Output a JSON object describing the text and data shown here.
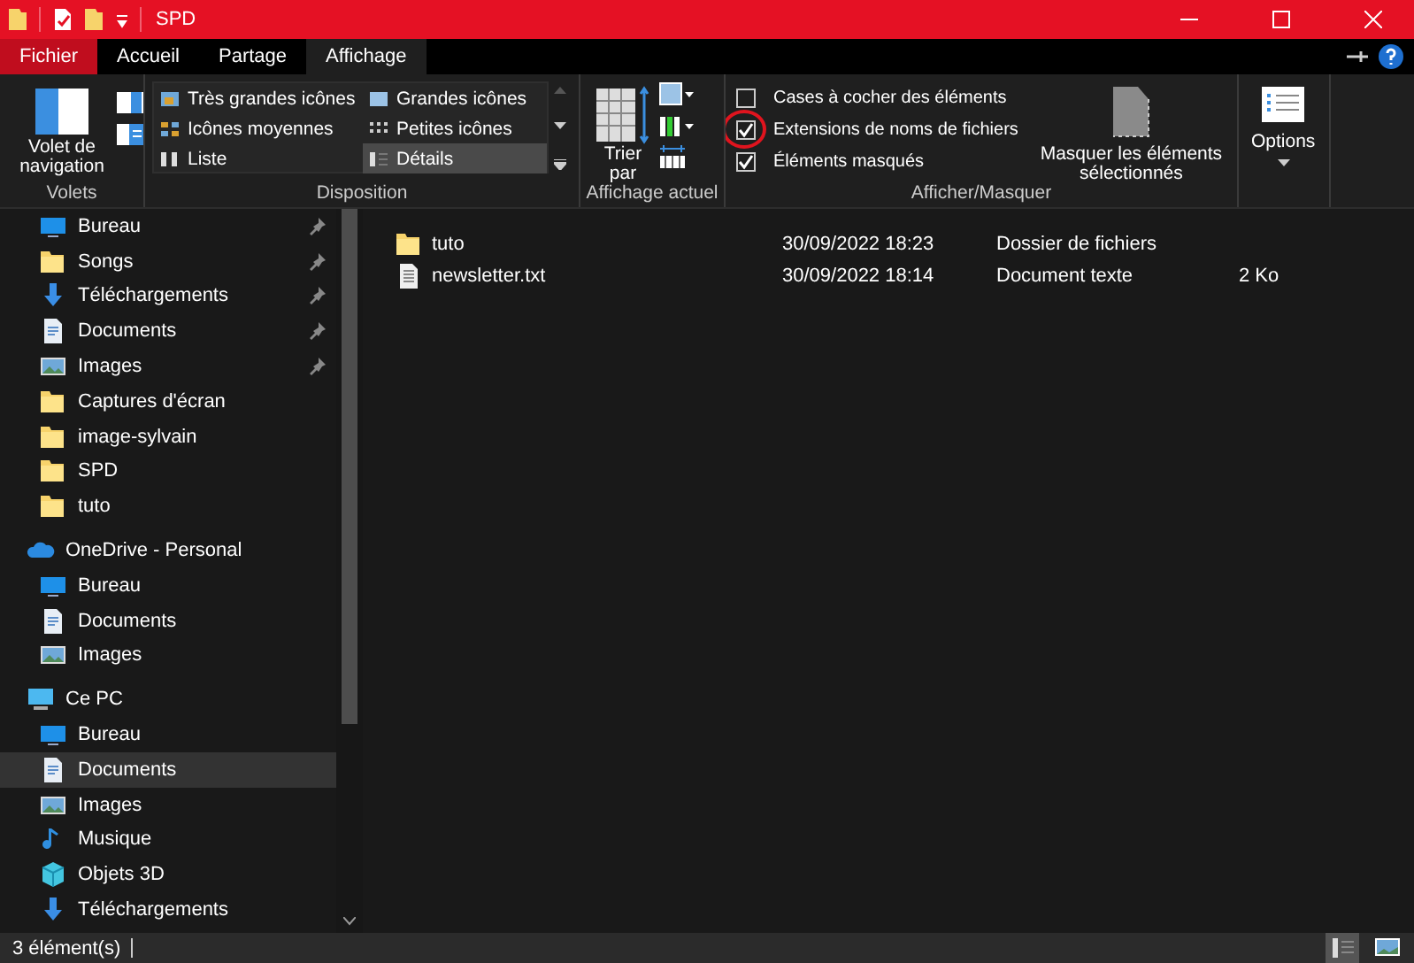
{
  "window": {
    "title": "SPD"
  },
  "tabs": [
    {
      "label": "Fichier",
      "kind": "file",
      "selected": false
    },
    {
      "label": "Accueil",
      "kind": "tab",
      "selected": false
    },
    {
      "label": "Partage",
      "kind": "tab",
      "selected": false
    },
    {
      "label": "Affichage",
      "kind": "tab",
      "selected": true
    }
  ],
  "ribbon": {
    "panes": {
      "nav_label": "Volet de navigation",
      "group": "Volets"
    },
    "layout": {
      "items": [
        {
          "label": "Très grandes icônes",
          "selected": false
        },
        {
          "label": "Grandes icônes",
          "selected": false
        },
        {
          "label": "Icônes moyennes",
          "selected": false
        },
        {
          "label": "Petites icônes",
          "selected": false
        },
        {
          "label": "Liste",
          "selected": false
        },
        {
          "label": "Détails",
          "selected": true
        }
      ],
      "group": "Disposition"
    },
    "current_view": {
      "sort_label": "Trier par",
      "group": "Affichage actuel"
    },
    "show_hide": {
      "checkboxes": [
        {
          "label": "Cases à cocher des éléments",
          "checked": false
        },
        {
          "label": "Extensions de noms de fichiers",
          "checked": true,
          "circled": true
        },
        {
          "label": "Éléments masqués",
          "checked": true,
          "circled": false
        }
      ],
      "hide_selected": "Masquer les éléments sélectionnés",
      "group": "Afficher/Masquer"
    },
    "options": {
      "label": "Options"
    }
  },
  "sidebar": {
    "quick_access": [
      {
        "label": "Bureau",
        "kind": "desktop",
        "pinned": true,
        "selected": false
      },
      {
        "label": "Songs",
        "kind": "folder",
        "pinned": true,
        "selected": false
      },
      {
        "label": "Téléchargements",
        "kind": "download",
        "pinned": true,
        "selected": false
      },
      {
        "label": "Documents",
        "kind": "document",
        "pinned": true,
        "selected": false
      },
      {
        "label": "Images",
        "kind": "images",
        "pinned": true,
        "selected": false
      },
      {
        "label": "Captures d'écran",
        "kind": "folder",
        "pinned": false,
        "selected": false
      },
      {
        "label": "image-sylvain",
        "kind": "folder",
        "pinned": false,
        "selected": false
      },
      {
        "label": "SPD",
        "kind": "folder",
        "pinned": false,
        "selected": false
      },
      {
        "label": "tuto",
        "kind": "folder",
        "pinned": false,
        "selected": false
      }
    ],
    "items": [
      {
        "label": "OneDrive - Personal",
        "kind": "cloud",
        "selected": false,
        "children": [
          {
            "label": "Bureau",
            "kind": "desktop",
            "selected": false
          },
          {
            "label": "Documents",
            "kind": "document",
            "selected": false
          },
          {
            "label": "Images",
            "kind": "images",
            "selected": false
          }
        ]
      },
      {
        "label": "Ce PC",
        "kind": "pc",
        "selected": false,
        "children": [
          {
            "label": "Bureau",
            "kind": "desktop",
            "selected": false
          },
          {
            "label": "Documents",
            "kind": "document",
            "selected": true
          },
          {
            "label": "Images",
            "kind": "images",
            "selected": false
          },
          {
            "label": "Musique",
            "kind": "music",
            "selected": false
          },
          {
            "label": "Objets 3D",
            "kind": "cube",
            "selected": false
          },
          {
            "label": "Téléchargements",
            "kind": "download",
            "selected": false
          }
        ]
      }
    ]
  },
  "files": [
    {
      "name": "tuto",
      "kind": "folder",
      "date": "30/09/2022 18:23",
      "type": "Dossier de fichiers"
    },
    {
      "name": "newsletter.txt",
      "kind": "text",
      "date": "30/09/2022 18:14",
      "type": "Document texte",
      "size": "2 Ko"
    }
  ],
  "status_bar": {
    "count": "3 élément(s)",
    "views": [
      {
        "kind": "details",
        "selected": true
      },
      {
        "kind": "large",
        "selected": false
      }
    ]
  }
}
